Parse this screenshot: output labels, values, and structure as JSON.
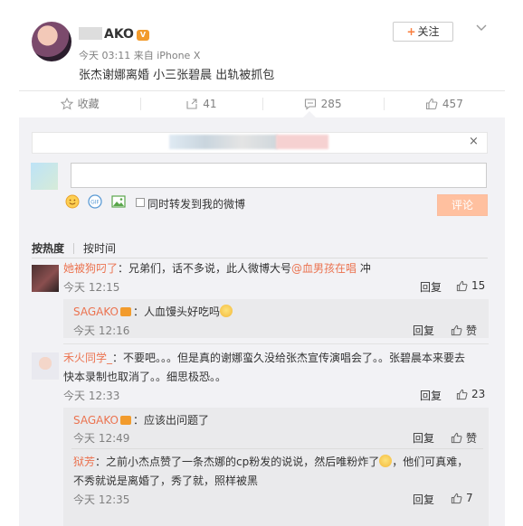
{
  "post": {
    "username_visible": "AKO",
    "meta": "今天 03:11 来自 iPhone X",
    "text": "张杰谢娜离婚 小三张碧晨 出轨被抓包",
    "follow_label": "关注",
    "follow_plus": "+"
  },
  "actions": {
    "favorite": "收藏",
    "repost_count": "41",
    "comment_count": "285",
    "like_count": "457"
  },
  "composer": {
    "input_value": "",
    "forward_label": "同时转发到我的微博",
    "submit_label": "评论",
    "close": "×"
  },
  "sort": {
    "by_hot": "按热度",
    "by_time": "按时间"
  },
  "comments": [
    {
      "name": "她被狗叼了",
      "text_pre": "：兄弟们，话不多说，此人微博大号",
      "mention": "@血男孩在唱",
      "text_post": " 冲",
      "time": "今天 12:15",
      "reply": "回复",
      "likes": "15",
      "sub": [
        {
          "name": "SAGAKO",
          "text": "：人血馒头好吃吗",
          "time": "今天 12:16",
          "reply": "回复",
          "likes": "赞"
        }
      ]
    },
    {
      "name": "禾火同学_",
      "text_line1": "：不要吧。。。但是真的谢娜蛮久没给张杰宣传演唱会了。。张碧晨本来要去",
      "text_line2": "快本录制也取消了。。细思极恐。。",
      "time": "今天 12:33",
      "reply": "回复",
      "likes": "23",
      "sub": [
        {
          "name": "SAGAKO",
          "text": "：应该出问题了",
          "time": "今天 12:49",
          "reply": "回复",
          "likes": "赞"
        },
        {
          "name": "狱芳",
          "text_line1a": "：之前小杰点赞了一条杰娜的cp粉发的说说，然后唯粉炸了",
          "text_line1b": "，他们可真难，",
          "text_line2": "不秀就说是离婚了，秀了就，照样被黑",
          "time": "今天 12:35",
          "reply": "回复",
          "likes": "7"
        }
      ]
    }
  ],
  "colors": {
    "accent_orange": "#eb7350",
    "panel_bg": "#f2f2f5",
    "submit_disabled": "#ffc09f"
  }
}
